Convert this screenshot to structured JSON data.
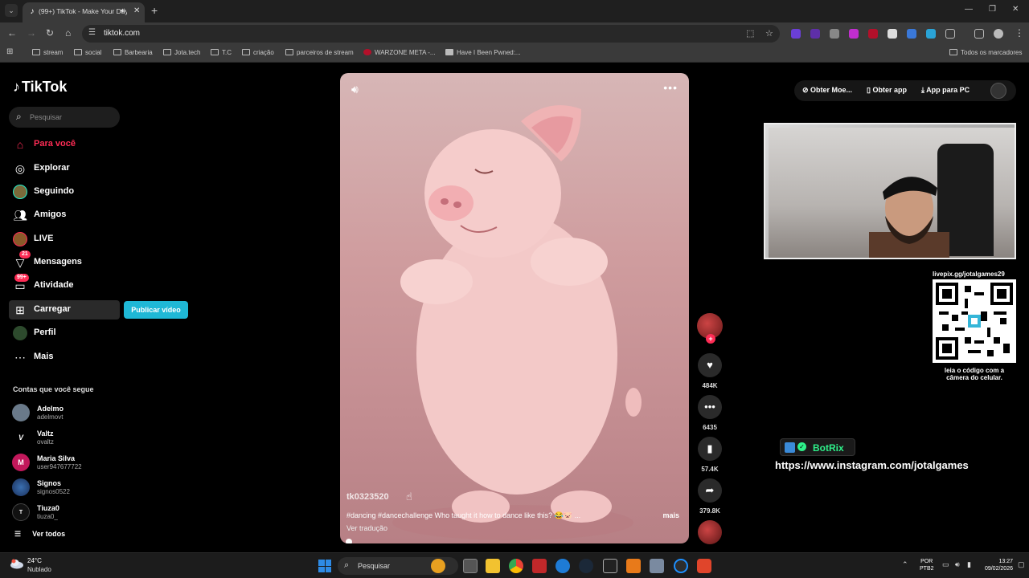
{
  "browser": {
    "tab_title": "(99+) TikTok - Make Your Day",
    "url": "tiktok.com",
    "bookmarks": [
      "stream",
      "social",
      "Barbearia",
      "Jota.tech",
      "T.C",
      "criação",
      "parceiros de stream",
      "WARZONE META -...",
      "Have I Been Pwned:...",
      "Todos os marcadores"
    ]
  },
  "tiktok": {
    "logo": "TikTok",
    "search_placeholder": "Pesquisar",
    "nav": [
      {
        "label": "Para você",
        "icon": "home-icon"
      },
      {
        "label": "Explorar",
        "icon": "compass-icon"
      },
      {
        "label": "Seguindo",
        "icon": "following-avatar-icon"
      },
      {
        "label": "Amigos",
        "icon": "friends-icon"
      },
      {
        "label": "LIVE",
        "icon": "live-icon"
      },
      {
        "label": "Mensagens",
        "icon": "messages-icon",
        "badge": "21"
      },
      {
        "label": "Atividade",
        "icon": "activity-icon",
        "badge": "99+"
      },
      {
        "label": "Carregar",
        "icon": "upload-icon"
      },
      {
        "label": "Perfil",
        "icon": "profile-icon"
      },
      {
        "label": "Mais",
        "icon": "more-icon"
      }
    ],
    "publish_button": "Publicar vídeo",
    "following_title": "Contas que você segue",
    "accounts": [
      {
        "name": "Adelmo",
        "handle": "adelmovt"
      },
      {
        "name": "Valtz",
        "handle": "ovaltz"
      },
      {
        "name": "Maria Silva",
        "handle": "user947677722"
      },
      {
        "name": "Signos",
        "handle": "signos0522"
      },
      {
        "name": "Tiuza0",
        "handle": "tiuza0_"
      }
    ],
    "see_all": "Ver todos",
    "header": {
      "coins": "Obter Moe...",
      "app": "Obter app",
      "pc_app": "App para PC"
    },
    "video": {
      "username": "tk0323520",
      "caption": "#dancing #dancechallenge Who taught it how to dance like this? 😂🐷 ...",
      "more": "mais",
      "translate": "Ver tradução",
      "likes": "484K",
      "comments": "6435",
      "saves": "57.4K",
      "shares": "379.8K"
    }
  },
  "overlay": {
    "qr_label": "livepix.gg/jotalgames29",
    "qr_caption": "leia o código com a câmera do celular.",
    "botrix": "BotRix",
    "instagram": "https://www.instagram.com/jotalgames"
  },
  "taskbar": {
    "temp": "24°C",
    "weather": "Nublado",
    "search": "Pesquisar",
    "lang": "POR",
    "kbd": "PTB2",
    "time": "13:27",
    "date": "09/02/2026"
  },
  "colors": {
    "accent": "#fe2c55",
    "publish": "#1fb8d6",
    "botrix": "#2ef08a"
  }
}
